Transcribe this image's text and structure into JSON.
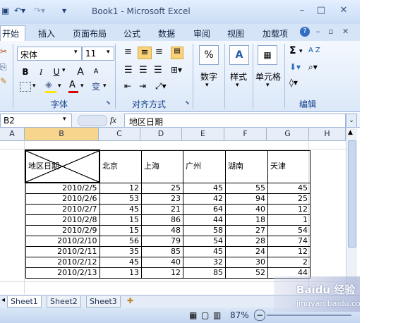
{
  "window": {
    "title": "Book1 - Microsoft Excel"
  },
  "tabs": [
    "开始",
    "插入",
    "页面布局",
    "公式",
    "数据",
    "审阅",
    "视图",
    "加载项"
  ],
  "ribbon": {
    "font_name": "宋体",
    "font_size": "11",
    "groups": {
      "font": "字体",
      "align": "对齐方式",
      "number": "数字",
      "style": "样式",
      "cells": "单元格",
      "edit": "编辑"
    },
    "number_btn": "%",
    "style_btn": "A",
    "bold": "B",
    "italic": "I",
    "underline": "U",
    "grow": "A",
    "shrink": "A",
    "font_color": "A",
    "phonetic": "变",
    "sum": "Σ",
    "sort": "A Z"
  },
  "formula_bar": {
    "name_box": "B2",
    "fx": "fx",
    "content": "地区日期"
  },
  "columns": [
    "A",
    "B",
    "C",
    "D",
    "E",
    "F",
    "G",
    "H"
  ],
  "table": {
    "header": [
      "地区日期",
      "北京",
      "上海",
      "广州",
      "湖南",
      "天津"
    ],
    "rows": [
      [
        "2010/2/5",
        "12",
        "25",
        "45",
        "55",
        "45"
      ],
      [
        "2010/2/6",
        "53",
        "23",
        "42",
        "94",
        "25"
      ],
      [
        "2010/2/7",
        "45",
        "21",
        "64",
        "40",
        "12"
      ],
      [
        "2010/2/8",
        "15",
        "86",
        "44",
        "18",
        "1"
      ],
      [
        "2010/2/9",
        "15",
        "48",
        "58",
        "27",
        "54"
      ],
      [
        "2010/2/10",
        "56",
        "79",
        "54",
        "28",
        "74"
      ],
      [
        "2010/2/11",
        "35",
        "85",
        "45",
        "24",
        "12"
      ],
      [
        "2010/2/12",
        "45",
        "40",
        "32",
        "30",
        "2"
      ],
      [
        "2010/2/13",
        "13",
        "12",
        "85",
        "52",
        "44"
      ]
    ]
  },
  "sheets": [
    "Sheet1",
    "Sheet2",
    "Sheet3"
  ],
  "status": {
    "zoom": "87%"
  },
  "watermark": {
    "text": "Baidu 经验",
    "url": "jingyan.baidu.com"
  },
  "colors": {
    "accent": "#1e5aa8",
    "header_selected": "#f8d58c"
  }
}
